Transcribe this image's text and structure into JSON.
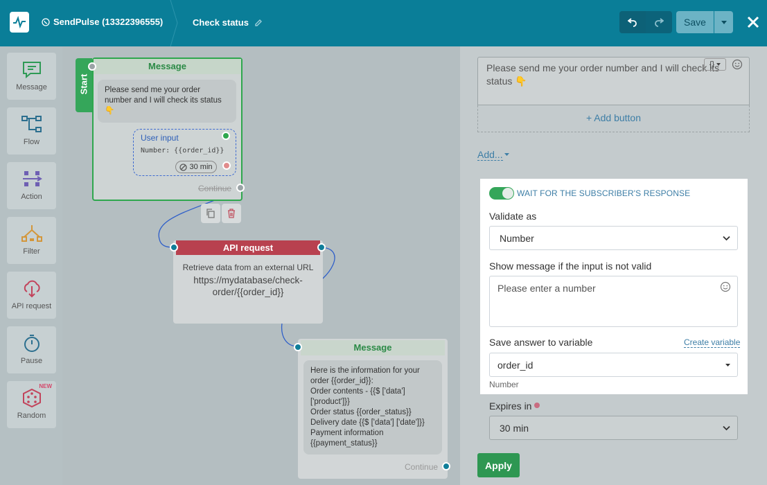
{
  "header": {
    "bot_name": "SendPulse (13322396555)",
    "flow_title": "Check status",
    "save_label": "Save"
  },
  "sidebar": {
    "items": [
      {
        "label": "Message",
        "icon": "message-icon"
      },
      {
        "label": "Flow",
        "icon": "flow-icon"
      },
      {
        "label": "Action",
        "icon": "action-icon"
      },
      {
        "label": "Filter",
        "icon": "filter-icon"
      },
      {
        "label": "API request",
        "icon": "api-request-icon"
      },
      {
        "label": "Pause",
        "icon": "pause-icon"
      },
      {
        "label": "Random",
        "icon": "random-icon",
        "badge": "NEW"
      }
    ]
  },
  "canvas": {
    "start_label": "Start",
    "message_node": {
      "title": "Message",
      "text": "Please send me your order number and I will check its status 👇",
      "user_input_title": "User input",
      "user_input_var": "Number: {{order_id}}",
      "user_input_time": "30 min",
      "continue_label": "Continue"
    },
    "api_node": {
      "title": "API request",
      "description": "Retrieve data from an external URL",
      "url": "https://mydatabase/check-order/{{order_id}}"
    },
    "message_node_2": {
      "title": "Message",
      "lines": [
        "Here is the information for your",
        "order {{order_id}}:",
        "Order contents - {{$ ['data']",
        "['product']}}",
        "Order status {{order_status}}",
        "Delivery date {{$ ['data'] ['date']}}",
        "Payment information",
        "{{payment_status}}"
      ],
      "continue_label": "Continue"
    }
  },
  "panel": {
    "message_text": "Please send me your order number and I will check its status 👇",
    "add_button_label": "+ Add button",
    "add_link_label": "Add...",
    "wait_label": "WAIT FOR THE SUBSCRIBER'S RESPONSE",
    "validate_label": "Validate as",
    "validate_value": "Number",
    "invalid_msg_label": "Show message if the input is not valid",
    "invalid_msg_placeholder": "Please enter a number",
    "save_var_label": "Save answer to variable",
    "create_variable_label": "Create variable",
    "variable_value": "order_id",
    "variable_type_hint": "Number",
    "expires_label": "Expires in",
    "expires_value": "30 min",
    "apply_label": "Apply"
  },
  "colors": {
    "header": "#0a7e98",
    "accent_green": "#35a65a",
    "api_red": "#b8414f",
    "link_blue": "#3d7ea6"
  }
}
